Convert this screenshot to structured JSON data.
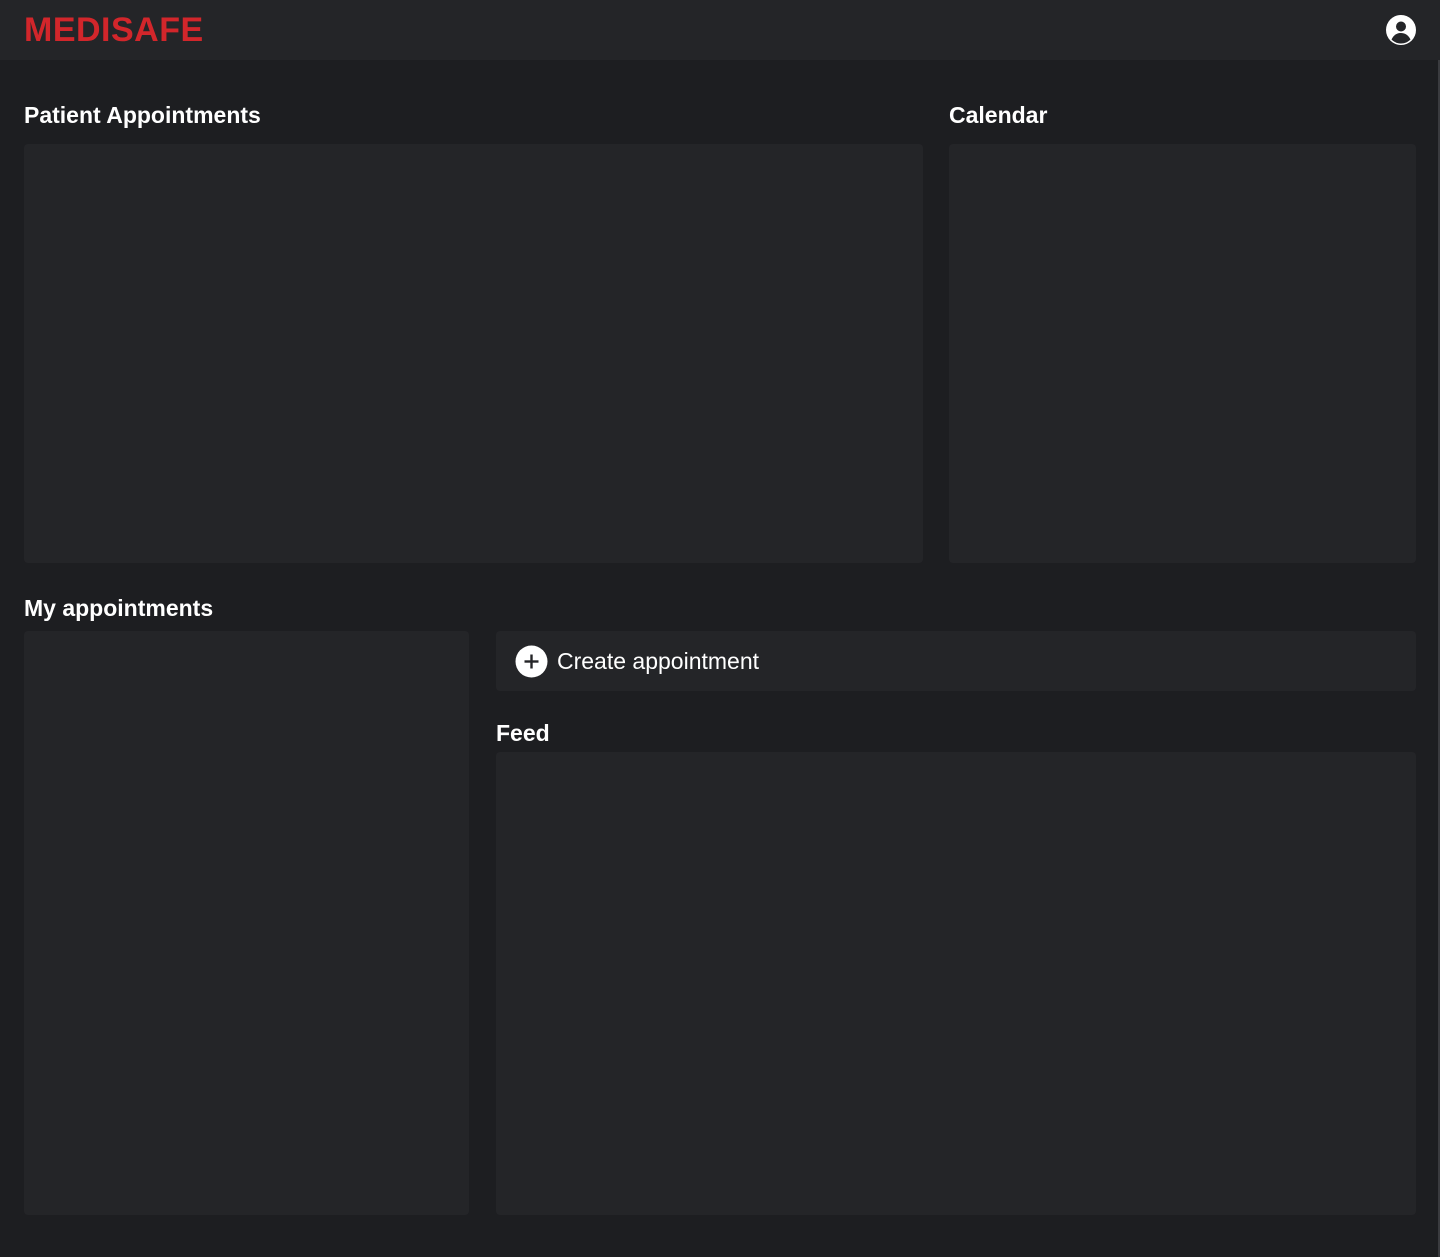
{
  "app": {
    "logo_text": "MEDISAFE",
    "brand_color": "#d2262b",
    "account_icon": "account-circle-icon"
  },
  "sections": {
    "patient_appointments_title": "Patient Appointments",
    "calendar_title": "Calendar",
    "my_appointments_title": "My appointments",
    "feed_title": "Feed"
  },
  "actions": {
    "create_appointment_label": "Create appointment",
    "create_appointment_icon": "plus-circle-icon"
  },
  "colors": {
    "background": "#1d1e21",
    "panel": "#242528",
    "text": "#ffffff"
  }
}
